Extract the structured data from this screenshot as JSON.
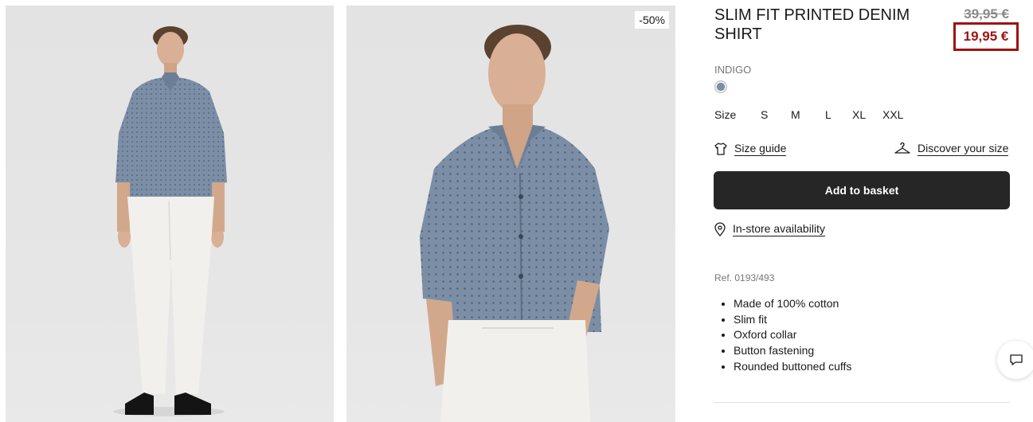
{
  "product": {
    "title": "SLIM FIT PRINTED DENIM SHIRT",
    "old_price": "39,95 €",
    "price": "19,95 €",
    "discount_badge": "-50%",
    "color_name": "INDIGO",
    "size_label": "Size",
    "sizes": [
      "S",
      "M",
      "L",
      "XL",
      "XXL"
    ],
    "size_guide": "Size guide",
    "discover_size": "Discover your size",
    "add_to_basket": "Add to basket",
    "store_availability": "In-store availability",
    "ref": "Ref. 0193/493",
    "features": [
      "Made of 100% cotton",
      "Slim fit",
      "Oxford collar",
      "Button fastening",
      "Rounded buttoned cuffs"
    ]
  },
  "colors": {
    "price_highlight": "#a01212",
    "button_bg": "#262626",
    "shirt": "#7b8ea6"
  }
}
